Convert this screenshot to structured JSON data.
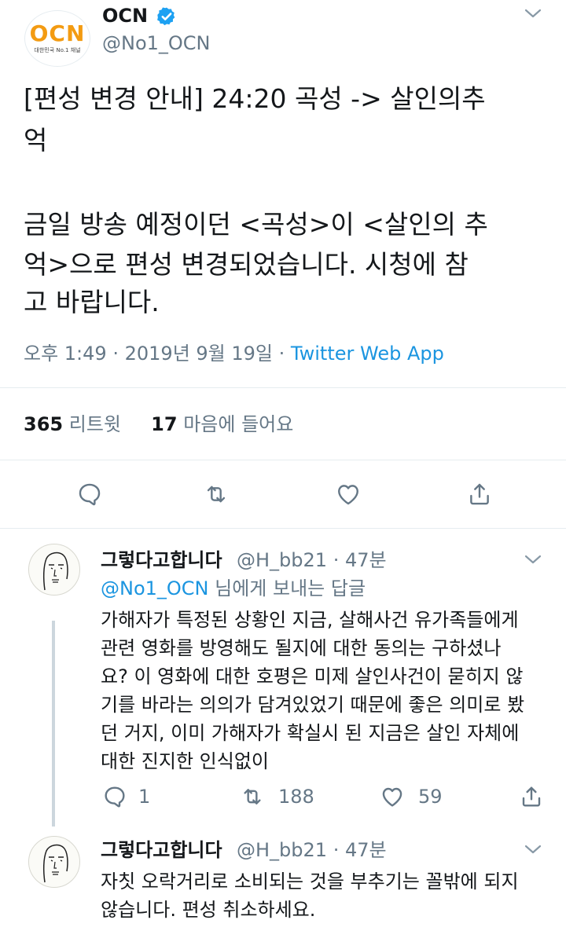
{
  "tweet": {
    "logo_text": "OCN",
    "logo_sub": "대한민국 No.1 채널",
    "name": "OCN",
    "handle": "@No1_OCN",
    "lines": [
      "[편성 변경 안내] 24:20 곡성 -> 살인의추",
      "억",
      "",
      "금일 방송 예정이던 <곡성>이 <살인의 추",
      "억>으로 편성 변경되었습니다. 시청에 참",
      "고 바랍니다."
    ],
    "time": "오후 1:49",
    "date": "2019년 9월 19일",
    "sep": "·",
    "source": "Twitter Web App",
    "retweet_count": "365",
    "retweet_label": "리트윗",
    "like_count": "17",
    "like_label": "마음에 들어요"
  },
  "replies": [
    {
      "name": "그렇다고합니다",
      "handle": "@H_bb21",
      "time": "· 47분",
      "reply_to_mention": "@No1_OCN",
      "reply_to_suffix": " 님에게 보내는 답글",
      "lines": [
        "가해자가 특정된 상황인 지금, 살해사건 유가족들에게",
        "관련 영화를 방영해도 될지에 대한 동의는 구하셨나",
        "요? 이 영화에 대한 호평은 미제 살인사건이 묻히지 않",
        "기를 바라는 의의가 담겨있었기 때문에 좋은 의미로 봤",
        "던 거지, 이미 가해자가 확실시 된 지금은 살인 자체에",
        "대한 진지한 인식없이"
      ],
      "reply_count": "1",
      "retweet_count": "188",
      "like_count": "59"
    },
    {
      "name": "그렇다고합니다",
      "handle": "@H_bb21",
      "time": "· 47분",
      "lines": [
        "자칫 오락거리로 소비되는 것을 부추기는 꼴밖에 되지",
        "않습니다. 편성 취소하세요."
      ]
    }
  ],
  "colors": {
    "accent": "#1b95e0",
    "secondary_text": "#657786",
    "logo_orange": "#f39b12"
  },
  "icons": [
    "verified-badge-icon",
    "chevron-down-icon",
    "reply-icon",
    "retweet-icon",
    "like-icon",
    "share-icon"
  ]
}
